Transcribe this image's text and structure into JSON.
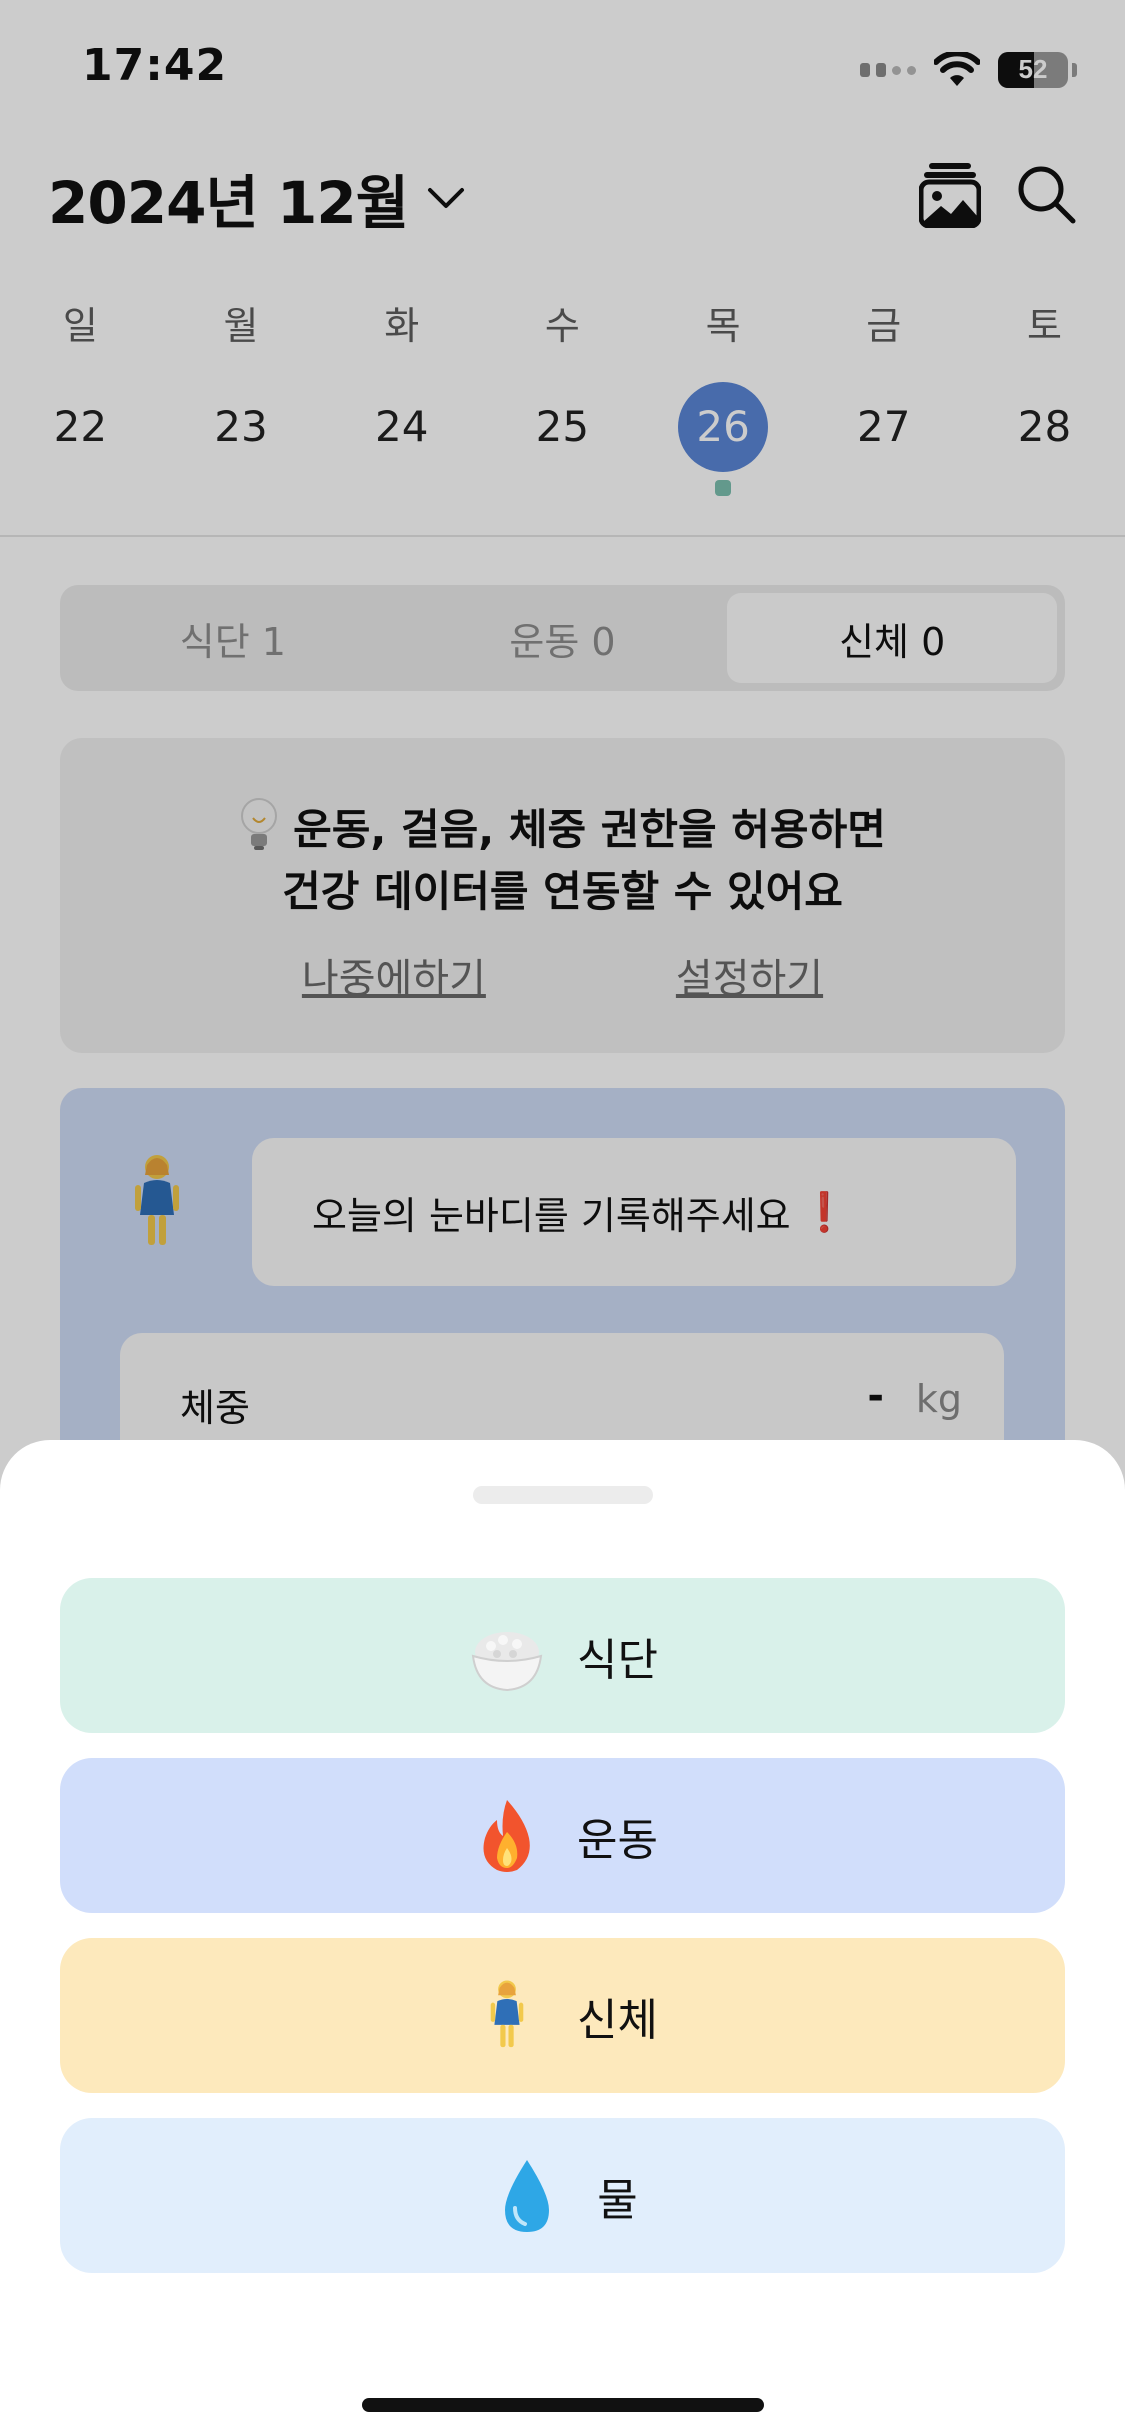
{
  "status_bar": {
    "time": "17:42",
    "battery": "52"
  },
  "header": {
    "month": "2024년 12월"
  },
  "week": {
    "labels": [
      "일",
      "월",
      "화",
      "수",
      "목",
      "금",
      "토"
    ],
    "dates": [
      "22",
      "23",
      "24",
      "25",
      "26",
      "27",
      "28"
    ],
    "selected_index": 4
  },
  "tabs": [
    {
      "label": "식단 1"
    },
    {
      "label": "운동 0"
    },
    {
      "label": "신체 0"
    }
  ],
  "permission_card": {
    "line1": "운동, 걸음, 체중 권한을 허용하면",
    "line2": "건강 데이터를 연동할 수 있어요",
    "later": "나중에하기",
    "settings": "설정하기"
  },
  "body_card": {
    "prompt": "오늘의 눈바디를 기록해주세요",
    "exclamation": "❗",
    "weight_label": "체중",
    "weight_value": "-",
    "weight_unit": "kg"
  },
  "sheet": {
    "options": [
      {
        "label": "식단",
        "icon": "rice-bowl-icon"
      },
      {
        "label": "운동",
        "icon": "fire-icon"
      },
      {
        "label": "신체",
        "icon": "woman-standing-icon"
      },
      {
        "label": "물",
        "icon": "water-drop-icon"
      }
    ]
  },
  "colors": {
    "selected_date": "#5a86d6",
    "meal": "#d9f1ea",
    "exercise": "#d1defb",
    "body": "#fde9bc",
    "water": "#e1eefc"
  }
}
